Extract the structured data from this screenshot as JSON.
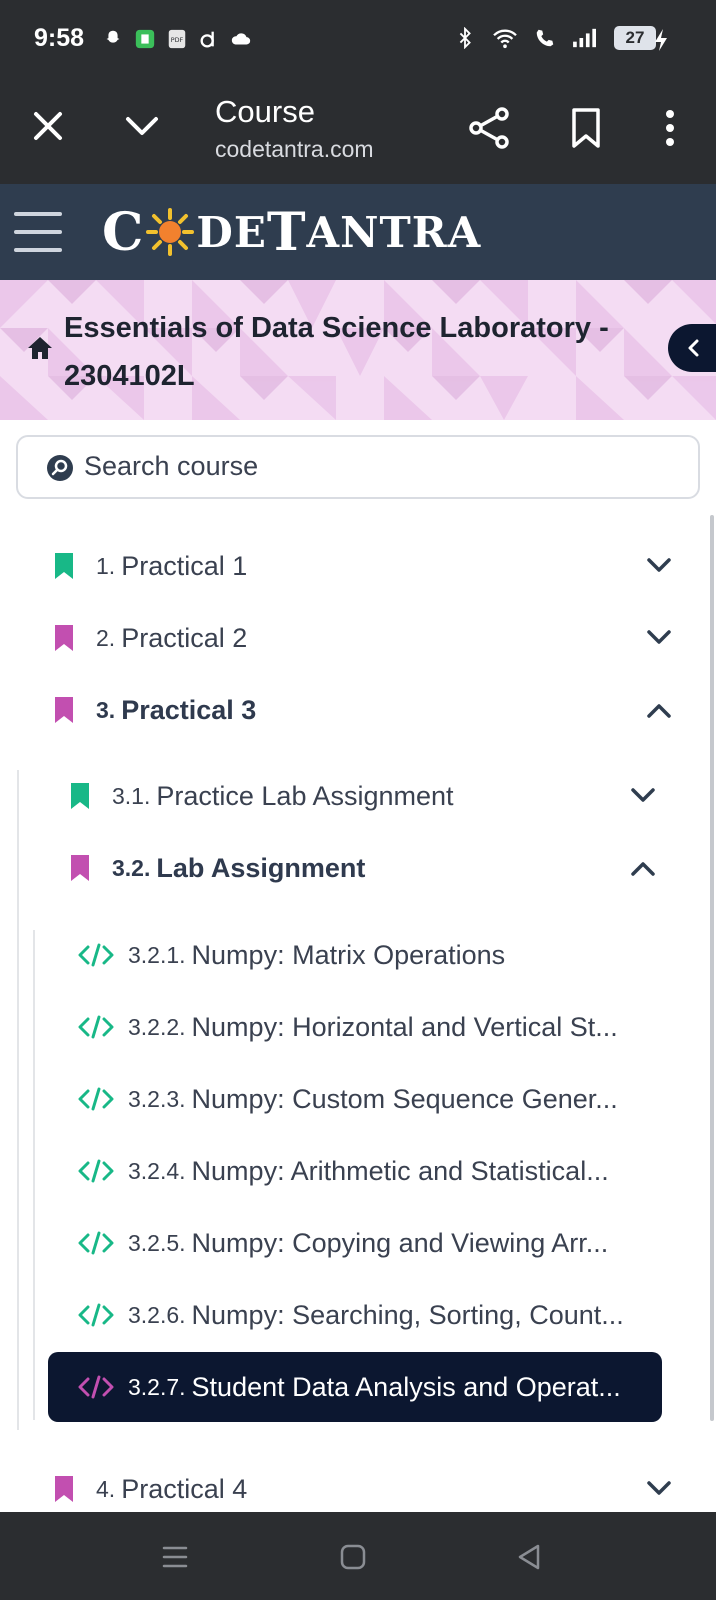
{
  "status_bar": {
    "time": "9:58",
    "battery": "27"
  },
  "browser": {
    "title": "Course",
    "url": "codetantra.com"
  },
  "header": {
    "logo": {
      "part1": "C",
      "part2": "DE",
      "part3": "T",
      "part4": "ANTRA"
    }
  },
  "course": {
    "title": "Essentials of Data Science Laboratory - 2304102L"
  },
  "search": {
    "placeholder": "Search course"
  },
  "tree": {
    "practicals": [
      {
        "num": "1.",
        "label": "Practical 1"
      },
      {
        "num": "2.",
        "label": "Practical 2"
      },
      {
        "num": "3.",
        "label": "Practical 3"
      },
      {
        "num": "4.",
        "label": "Practical 4"
      }
    ],
    "sections": [
      {
        "num": "3.1.",
        "label": "Practice Lab Assignment"
      },
      {
        "num": "3.2.",
        "label": "Lab Assignment"
      }
    ],
    "items": [
      {
        "num": "3.2.1.",
        "label": "Numpy: Matrix Operations"
      },
      {
        "num": "3.2.2.",
        "label": "Numpy: Horizontal and Vertical St..."
      },
      {
        "num": "3.2.3.",
        "label": "Numpy: Custom Sequence Gener..."
      },
      {
        "num": "3.2.4.",
        "label": "Numpy: Arithmetic and Statistical..."
      },
      {
        "num": "3.2.5.",
        "label": "Numpy: Copying and Viewing Arr..."
      },
      {
        "num": "3.2.6.",
        "label": "Numpy: Searching, Sorting, Count..."
      },
      {
        "num": "3.2.7.",
        "label": "Student Data Analysis and Operat..."
      }
    ]
  },
  "colors": {
    "green": "#18b887",
    "magenta": "#c24fb0",
    "navy": "#0c1730",
    "header": "#2f3d4f",
    "chrome": "#2b2d30"
  }
}
